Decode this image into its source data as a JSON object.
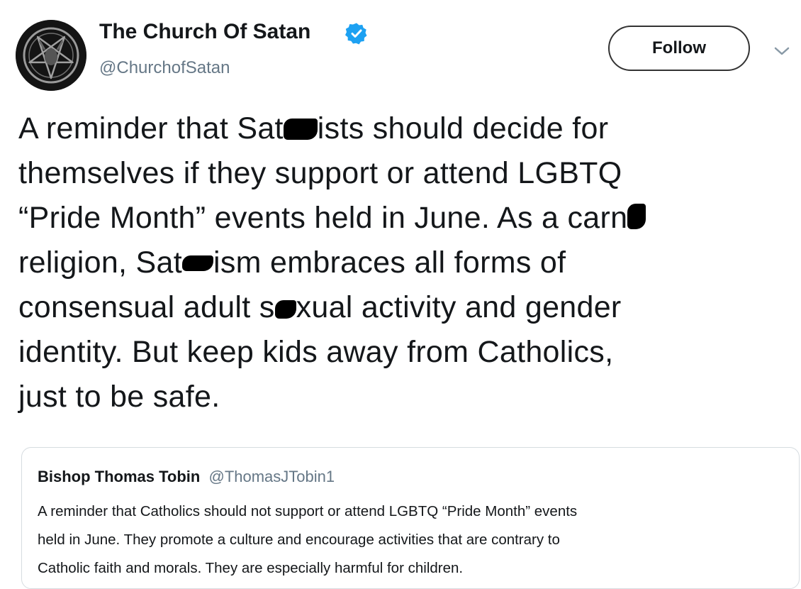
{
  "tweet": {
    "author": {
      "display_name": "The Church Of Satan",
      "handle": "@ChurchofSatan",
      "verified": true
    },
    "follow_label": "Follow",
    "text_lines": [
      {
        "before": "A reminder that Sat",
        "after": "ists should decide for"
      },
      {
        "text": "themselves if they support or attend LGBTQ"
      },
      {
        "before": "“Pride Month” events held in June. As a carn",
        "after": ""
      },
      {
        "before": "religion, Sat",
        "after": "ism embraces all forms of"
      },
      {
        "before": "consensual adult s",
        "after": "xual activity and gender"
      },
      {
        "text": "identity. But keep kids away from Catholics,"
      },
      {
        "text": "just to be safe."
      }
    ]
  },
  "quoted_tweet": {
    "display_name": "Bishop Thomas Tobin",
    "handle": "@ThomasJTobin1",
    "text_lines": [
      "A reminder that Catholics should not support or attend LGBTQ “Pride Month” events",
      "held in June. They promote a culture and encourage activities that are contrary to",
      "Catholic faith and morals. They are especially harmful for children."
    ]
  },
  "colors": {
    "text": "#14171a",
    "secondary_text": "#657786",
    "verified_blue": "#1da1f2",
    "card_border": "#d6dce0"
  },
  "icons": {
    "avatar": "pentagram-logo",
    "verified": "verified-badge-icon",
    "more": "chevron-down-icon"
  }
}
